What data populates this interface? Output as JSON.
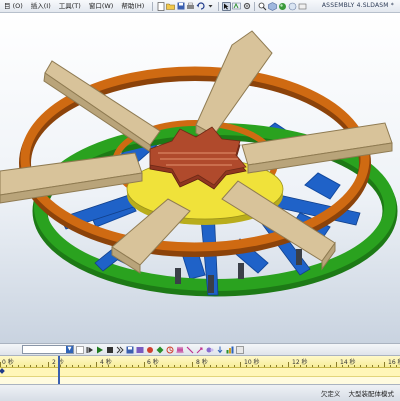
{
  "menubar": {
    "items": [
      "目 (O)",
      "插入(I)",
      "工具(T)",
      "窗口(W)",
      "帮助(H)"
    ],
    "document_title": "ASSEMBLY 4.SLDASM *"
  },
  "toolbar": {
    "icons": [
      "new-icon",
      "open-icon",
      "save-icon",
      "print-icon",
      "undo-icon",
      "select-icon",
      "rebuild-icon",
      "options-icon",
      "zoom-icon",
      "view-orientation-icon",
      "display-style-icon"
    ]
  },
  "motion": {
    "study_name": "",
    "timeline_labels": [
      "0 秒",
      "2 秒",
      "4 秒",
      "6 秒",
      "8 秒",
      "10 秒",
      "12 秒",
      "14 秒",
      "16 秒"
    ],
    "current_time_fraction": 0.145
  },
  "status": {
    "user": "欠定义",
    "mode": "大型装配体模式"
  },
  "colors": {
    "orange_ring": "#cf6a12",
    "green_ring": "#2aa21f",
    "blue_spokes": "#1f62c8",
    "wood_arms": "#d8c39a",
    "center_hub": "#b04a2c",
    "yellow_disk": "#f0e23a",
    "timeline_bg": "#fffbe0"
  }
}
